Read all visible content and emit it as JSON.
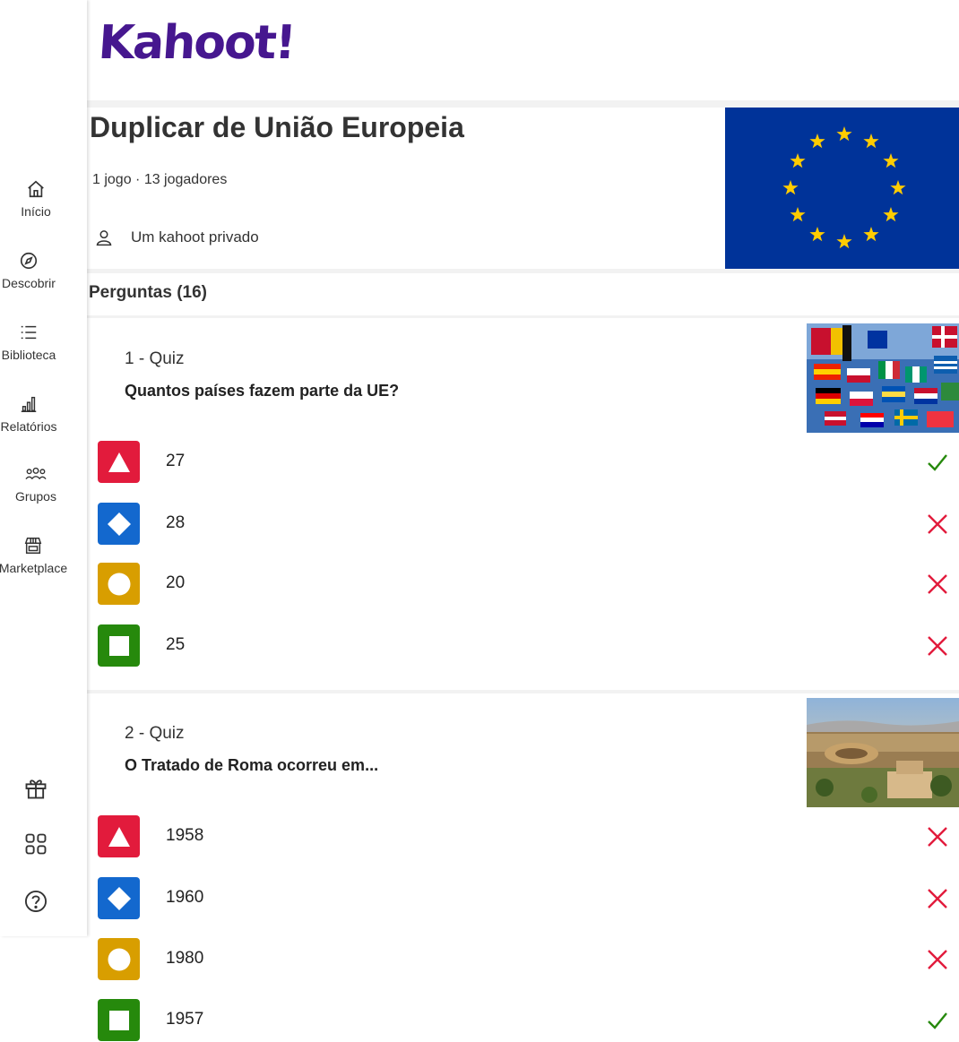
{
  "brand": {
    "logo_text": "Kahoot!",
    "color": "#46178f"
  },
  "sidebar": {
    "items": [
      {
        "label": "Início",
        "icon": "home-icon"
      },
      {
        "label": "Descobrir",
        "icon": "compass-icon"
      },
      {
        "label": "Biblioteca",
        "icon": "list-icon"
      },
      {
        "label": "Relatórios",
        "icon": "chart-icon"
      },
      {
        "label": "Grupos",
        "icon": "group-icon"
      },
      {
        "label": "Marketplace",
        "icon": "store-icon"
      }
    ],
    "bottom_icons": [
      "gift-icon",
      "apps-icon",
      "help-icon"
    ]
  },
  "kahoot": {
    "title": "Duplicar de União Europeia",
    "meta": "1 jogo · 13 jogadores",
    "visibility": "Um kahoot privado"
  },
  "questions_heading": "Perguntas (16)",
  "questions": [
    {
      "header": "1 - Quiz",
      "text": "Quantos países fazem parte da UE?",
      "answers": [
        {
          "text": "27",
          "correct": true
        },
        {
          "text": "28",
          "correct": false
        },
        {
          "text": "20",
          "correct": false
        },
        {
          "text": "25",
          "correct": false
        }
      ]
    },
    {
      "header": "2 - Quiz",
      "text": "O Tratado de Roma ocorreu em...",
      "answers": [
        {
          "text": "1958",
          "correct": false
        },
        {
          "text": "1960",
          "correct": false
        },
        {
          "text": "1980",
          "correct": false
        },
        {
          "text": "1957",
          "correct": true
        }
      ]
    }
  ],
  "colors": {
    "red": "#e21b3c",
    "blue": "#1368ce",
    "yellow": "#d89e00",
    "green": "#26890c",
    "check": "#26890c",
    "cross": "#e21b3c"
  }
}
